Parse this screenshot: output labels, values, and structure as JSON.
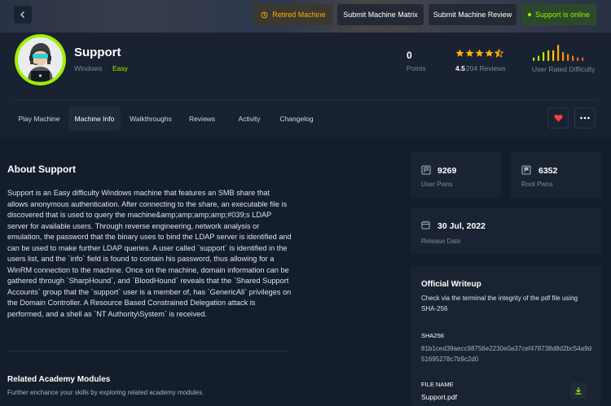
{
  "header": {
    "top_buttons": {
      "retired": "Retired Machine",
      "matrix": "Submit Machine Matrix",
      "review": "Submit Machine Review",
      "online": "Support is online"
    }
  },
  "machine": {
    "name": "Support",
    "os": "Windows",
    "separator": "·",
    "difficulty": "Easy",
    "points_value": "0",
    "points_label": "Points",
    "rating_value": "4.5",
    "rating_label": "204 Reviews",
    "rating_stars": 4.5,
    "difficulty_label": "User Rated Difficulty",
    "difficulty_chart": [
      2,
      3,
      5,
      6,
      6,
      9,
      5,
      4,
      3,
      2,
      2
    ]
  },
  "tabs": [
    "Play Machine",
    "Machine Info",
    "Walkthroughs",
    "Reviews",
    "Activity",
    "Changelog"
  ],
  "about": {
    "title": "About Support",
    "text": "Support is an Easy difficulty Windows machine that features an SMB share that allows anonymous authentication. After connecting to the share, an executable file is discovered that is used to query the machine&amp;amp;amp;amp;#039;s LDAP server for available users. Through reverse engineering, network analysis or emulation, the password that the binary uses to bind the LDAP server is identified and can be used to make further LDAP queries. A user called `support` is identified in the users list, and the `info` field is found to contain his password, thus allowing for a WinRM connection to the machine. Once on the machine, domain information can be gathered through `SharpHound`, and `BloodHound` reveals that the `Shared Support Accounts` group that the `support` user is a member of, has `GenericAll` privileges on the Domain Controller. A Resource Based Constrained Delegation attack is performed, and a shell as `NT Authority\\System` is received."
  },
  "modules": {
    "title": "Related Academy Modules",
    "subtitle": "Further enchance your skills by exploring related academy modules."
  },
  "stats": {
    "user_pwns_value": "9269",
    "user_pwns_label": "User Pwns",
    "root_pwns_value": "6352",
    "root_pwns_label": "Root Pwns",
    "release_value": "30 Jul, 2022",
    "release_label": "Release Date"
  },
  "writeup": {
    "title": "Official Writeup",
    "description": "Check via the terminal the integrity of the pdf file using SHA-256",
    "sha_label": "SHA256",
    "sha_value": "81b1ced39aecc98756e2230e0a37cef478738d8d2bc54a9d51695278c7b9c2d0",
    "file_label": "FILE NAME",
    "file_value": "Support.pdf"
  },
  "colors": {
    "accent_green": "#9fef00",
    "retired_orange": "#ffaf00",
    "heart_red": "#ff3e3e",
    "background": "#141d2b",
    "card": "#1a2332"
  }
}
